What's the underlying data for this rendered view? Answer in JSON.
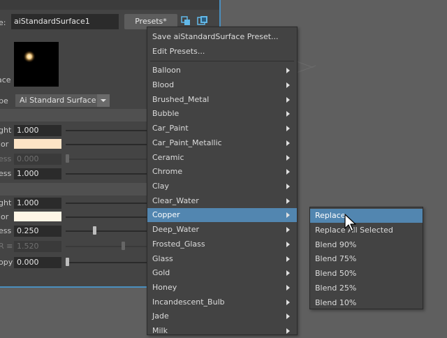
{
  "editor": {
    "name_label_tail": "e:",
    "node_name": "aiStandardSurface1",
    "presets_button": "Presets*",
    "swatch_label_tail": "ace",
    "type_label_tail": "pe",
    "type_value": "Ai Standard Surface",
    "rows": [
      {
        "label": "ght",
        "value": "1.000"
      },
      {
        "label": "lor",
        "color": "#fde4c6"
      },
      {
        "label": "ess",
        "value": "0.000"
      },
      {
        "label": "ess",
        "value": "1.000"
      },
      {
        "label": "ght",
        "value": "1.000"
      },
      {
        "label": "lor",
        "color": "#fff6e6"
      },
      {
        "label": "ess",
        "value": "0.250"
      },
      {
        "label": "R ≡",
        "value": "1.520"
      },
      {
        "label": "opy",
        "value": "0.000"
      }
    ]
  },
  "presets_menu": {
    "save_item": "Save aiStandardSurface Preset...",
    "edit_item": "Edit Presets...",
    "items": [
      "Balloon",
      "Blood",
      "Brushed_Metal",
      "Bubble",
      "Car_Paint",
      "Car_Paint_Metallic",
      "Ceramic",
      "Chrome",
      "Clay",
      "Clear_Water",
      "Copper",
      "Deep_Water",
      "Frosted_Glass",
      "Glass",
      "Gold",
      "Honey",
      "Incandescent_Bulb",
      "Jade",
      "Milk"
    ],
    "highlighted": "Copper"
  },
  "copper_submenu": {
    "items": [
      "Replace",
      "Replace All Selected",
      "Blend 90%",
      "Blend 75%",
      "Blend 50%",
      "Blend 25%",
      "Blend 10%"
    ],
    "highlighted": "Replace"
  },
  "colors": {
    "highlight": "#5286b0",
    "panel_border": "#4a8fbf"
  }
}
